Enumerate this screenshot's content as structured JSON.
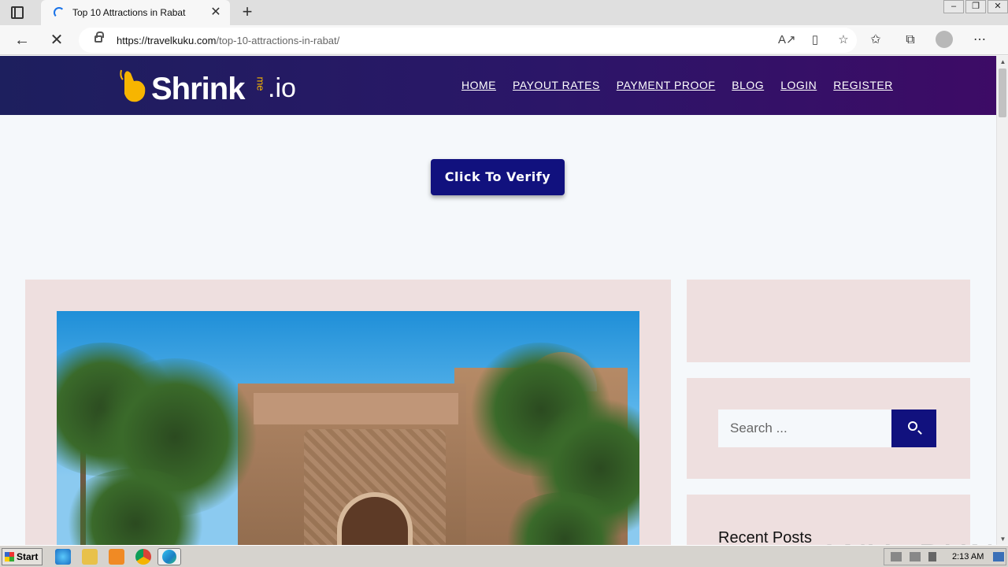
{
  "browser": {
    "tab_title": "Top 10 Attractions in Rabat",
    "url_domain": "https://travelkuku.com",
    "url_path": "/top-10-attractions-in-rabat/",
    "new_tab_label": "+",
    "tab_close_label": "✕"
  },
  "site": {
    "logo": {
      "shrink": "Shrink",
      "me": "me",
      "io": ".io"
    },
    "menu": [
      "HOME",
      "PAYOUT RATES",
      "PAYMENT PROOF",
      "BLOG",
      "LOGIN",
      "REGISTER"
    ],
    "verify_label": "Click To Verify"
  },
  "sidebar": {
    "search_placeholder": "Search ...",
    "recent_posts_title": "Recent Posts"
  },
  "watermark": "ANY▷RUN",
  "taskbar": {
    "start_label": "Start",
    "clock": "2:13 AM"
  },
  "colors": {
    "header_gradient_start": "#1d1f5e",
    "header_gradient_end": "#3d0b66",
    "button_navy": "#11117e",
    "card_bg": "#eedfdf",
    "logo_accent": "#f7b500"
  }
}
